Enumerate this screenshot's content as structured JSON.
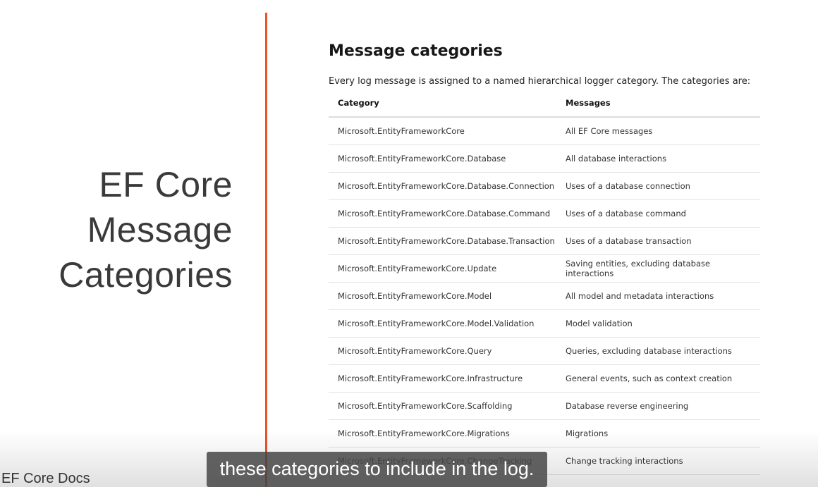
{
  "slide": {
    "title_lines": [
      "EF Core",
      "Message",
      "Categories"
    ],
    "footer": "EF Core Docs"
  },
  "doc": {
    "heading": "Message categories",
    "intro": "Every log message is assigned to a named hierarchical logger category. The categories are:",
    "columns": [
      "Category",
      "Messages"
    ],
    "rows": [
      [
        "Microsoft.EntityFrameworkCore",
        "All EF Core messages"
      ],
      [
        "Microsoft.EntityFrameworkCore.Database",
        "All database interactions"
      ],
      [
        "Microsoft.EntityFrameworkCore.Database.Connection",
        "Uses of a database connection"
      ],
      [
        "Microsoft.EntityFrameworkCore.Database.Command",
        "Uses of a database command"
      ],
      [
        "Microsoft.EntityFrameworkCore.Database.Transaction",
        "Uses of a database transaction"
      ],
      [
        "Microsoft.EntityFrameworkCore.Update",
        "Saving entities, excluding database interactions"
      ],
      [
        "Microsoft.EntityFrameworkCore.Model",
        "All model and metadata interactions"
      ],
      [
        "Microsoft.EntityFrameworkCore.Model.Validation",
        "Model validation"
      ],
      [
        "Microsoft.EntityFrameworkCore.Query",
        "Queries, excluding database interactions"
      ],
      [
        "Microsoft.EntityFrameworkCore.Infrastructure",
        "General events, such as context creation"
      ],
      [
        "Microsoft.EntityFrameworkCore.Scaffolding",
        "Database reverse engineering"
      ],
      [
        "Microsoft.EntityFrameworkCore.Migrations",
        "Migrations"
      ],
      [
        "Microsoft.EntityFrameworkCore.ChangeTracking",
        "Change tracking interactions"
      ]
    ]
  },
  "caption": "these categories to include in the log.",
  "colors": {
    "accent": "#e8532a"
  }
}
